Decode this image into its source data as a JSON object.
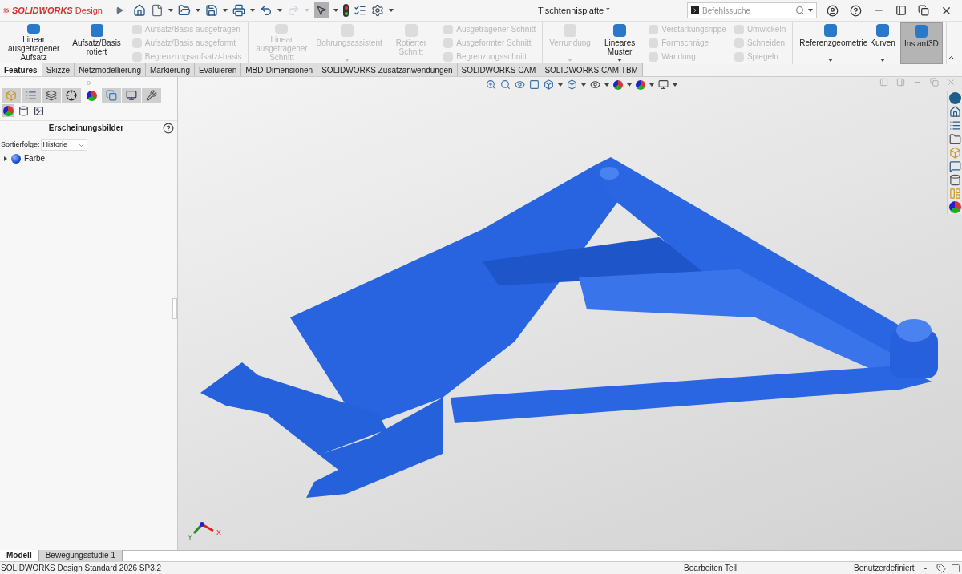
{
  "titlebar": {
    "logo_bold": "SOLIDWORKS",
    "logo_light": "Design",
    "document_title": "Tischtennisplatte *",
    "search": {
      "placeholder": "Befehlssuche"
    }
  },
  "ribbon": {
    "groups": [
      {
        "items": [
          {
            "label": "Linear ausgetragener Aufsatz",
            "kind": "large",
            "disabled": false,
            "pressed": false,
            "menu": false
          },
          {
            "label": "Aufsatz/Basis rotiert",
            "kind": "large",
            "disabled": false,
            "pressed": false,
            "menu": false
          },
          {
            "label": "Aufsatz/Basis ausgetragen",
            "kind": "small",
            "disabled": true,
            "pressed": false
          },
          {
            "label": "Aufsatz/Basis ausgeformt",
            "kind": "small",
            "disabled": true,
            "pressed": false
          },
          {
            "label": "Begrenzungsaufsatz/-basis",
            "kind": "small",
            "disabled": true,
            "pressed": false
          }
        ]
      },
      {
        "items": [
          {
            "label": "Linear ausgetragener Schnitt",
            "kind": "large",
            "disabled": true,
            "pressed": false,
            "menu": false
          },
          {
            "label": "Bohrungsassistent",
            "kind": "large",
            "disabled": true,
            "pressed": false,
            "menu": true
          },
          {
            "label": "Rotierter Schnitt",
            "kind": "large",
            "disabled": true,
            "pressed": false,
            "menu": false
          },
          {
            "label": "Ausgetragener Schnitt",
            "kind": "small",
            "disabled": true,
            "pressed": false
          },
          {
            "label": "Ausgeformter Schnitt",
            "kind": "small",
            "disabled": true,
            "pressed": false
          },
          {
            "label": "Begrenzungsschnitt",
            "kind": "small",
            "disabled": true,
            "pressed": false
          }
        ]
      },
      {
        "items": [
          {
            "label": "Verrundung",
            "kind": "large",
            "disabled": true,
            "pressed": false,
            "menu": true
          },
          {
            "label": "Lineares Muster",
            "kind": "large",
            "disabled": false,
            "pressed": false,
            "menu": true
          },
          {
            "label": "Verstärkungsrippe",
            "kind": "small",
            "disabled": true,
            "pressed": false
          },
          {
            "label": "Formschräge",
            "kind": "small",
            "disabled": true,
            "pressed": false
          },
          {
            "label": "Wandung",
            "kind": "small",
            "disabled": true,
            "pressed": false
          },
          {
            "label": "Umwickeln",
            "kind": "small",
            "disabled": true,
            "pressed": false
          },
          {
            "label": "Schneiden",
            "kind": "small",
            "disabled": true,
            "pressed": false
          },
          {
            "label": "Spiegeln",
            "kind": "small",
            "disabled": true,
            "pressed": false
          }
        ]
      },
      {
        "items": [
          {
            "label": "Referenzgeometrie",
            "kind": "large",
            "disabled": false,
            "pressed": false,
            "menu": true
          },
          {
            "label": "Kurven",
            "kind": "large",
            "disabled": false,
            "pressed": false,
            "menu": true
          },
          {
            "label": "Instant3D",
            "kind": "large",
            "disabled": false,
            "pressed": true,
            "menu": false
          }
        ]
      }
    ]
  },
  "command_tabs": [
    {
      "label": "Features",
      "selected": true
    },
    {
      "label": "Skizze",
      "selected": false
    },
    {
      "label": "Netzmodellierung",
      "selected": false
    },
    {
      "label": "Markierung",
      "selected": false
    },
    {
      "label": "Evaluieren",
      "selected": false
    },
    {
      "label": "MBD-Dimensionen",
      "selected": false
    },
    {
      "label": "SOLIDWORKS Zusatzanwendungen",
      "selected": false
    },
    {
      "label": "SOLIDWORKS CAM",
      "selected": false
    },
    {
      "label": "SOLIDWORKS CAM TBM",
      "selected": false
    }
  ],
  "manager_tabs": [
    {
      "kind": "feature",
      "selected": false
    },
    {
      "kind": "property",
      "selected": false
    },
    {
      "kind": "config",
      "selected": false
    },
    {
      "kind": "dimxpert",
      "selected": false
    },
    {
      "kind": "appearance",
      "selected": true
    },
    {
      "kind": "cam",
      "selected": false
    },
    {
      "kind": "camtbm",
      "selected": false
    },
    {
      "kind": "tool",
      "selected": false
    }
  ],
  "appearance_tabs": [
    {
      "kind": "appearance",
      "selected": true
    },
    {
      "kind": "scene",
      "selected": false
    },
    {
      "kind": "decal",
      "selected": false
    }
  ],
  "panel": {
    "title": "Erscheinungsbilder",
    "sort_label": "Sortierfolge:",
    "sort_value": "Historie",
    "tree": [
      {
        "label": "Farbe",
        "expanded": false
      }
    ]
  },
  "triad": {
    "x_label": "X",
    "y_label": "Y"
  },
  "bottom_tabs": [
    {
      "label": "Modell",
      "selected": true
    },
    {
      "label": "Bewegungsstudie 1",
      "selected": false
    }
  ],
  "status_bar": {
    "product": "SOLIDWORKS Design Standard 2026 SP3.2",
    "mode": "Bearbeiten Teil",
    "units": "Benutzerdefiniert",
    "separator": "-"
  }
}
